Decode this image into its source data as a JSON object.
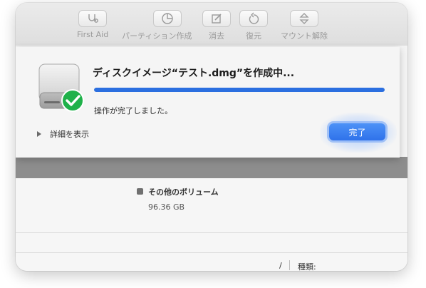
{
  "toolbar": {
    "buttons": [
      {
        "label": "First Aid",
        "icon": "stethoscope-icon"
      },
      {
        "label": "パーティション作成",
        "icon": "partition-pie-icon"
      },
      {
        "label": "消去",
        "icon": "erase-icon"
      },
      {
        "label": "復元",
        "icon": "restore-icon"
      },
      {
        "label": "マウント解除",
        "icon": "unmount-icon"
      }
    ]
  },
  "sheet": {
    "title": "ディスクイメージ“テスト.dmg”を作成中...",
    "progress": 1.0,
    "status": "操作が完了しました。",
    "details_label": "詳細を表示",
    "done_label": "完了"
  },
  "volume": {
    "name": "その他のボリューム",
    "size": "96.36 GB"
  },
  "info": {
    "slash": "/",
    "kind_label": "種類:"
  },
  "colors": {
    "accent": "#2f72ea",
    "progress": "#2b6fe0",
    "checkmark": "#1fb14a",
    "band": "#8d8d8d"
  }
}
